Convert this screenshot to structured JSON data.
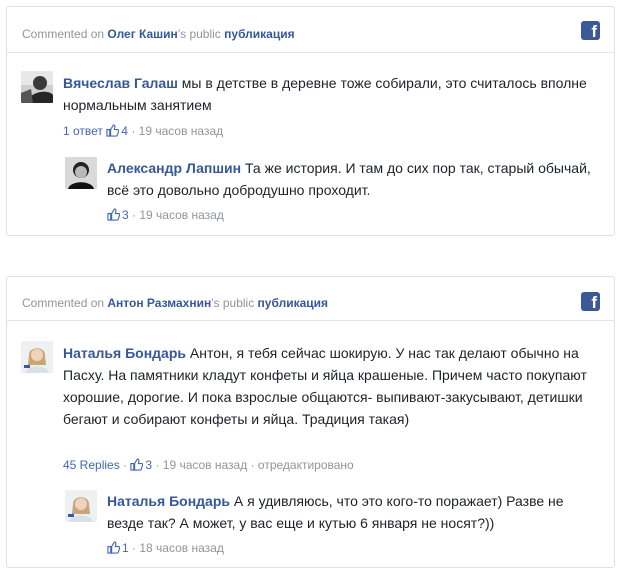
{
  "cards": [
    {
      "header": {
        "prefix": "Commented on",
        "page_name": "Олег Кашин",
        "possessive": "'s public",
        "link": "публикация",
        "fb_glyph": "f"
      },
      "comment": {
        "author": "Вячеслав Галаш",
        "text": "мы в детстве в деревне тоже собирали, это считалось вполне нормальным занятием",
        "replies": "1 ответ",
        "likes": "4",
        "time": "19 часов назад"
      },
      "reply": {
        "author": "Александр Лапшин",
        "text": "Та же история. И там до сих пор так, старый обычай, всё это довольно добродушно проходит.",
        "likes": "3",
        "time": "19 часов назад"
      }
    },
    {
      "header": {
        "prefix": "Commented on",
        "page_name": "Антон Размахнин",
        "possessive": "'s public",
        "link": "публикация",
        "fb_glyph": "f"
      },
      "comment": {
        "author": "Наталья Бондарь",
        "text": "Антон, я тебя сейчас шокирую. У нас так делают обычно на Пасху. На памятники кладут конфеты и яйца крашеные. Причем часто покупают хорошие, дорогие. И пока взрослые общаются- выпивают-закусывают, детишки бегают и собирают конфеты и яйца. Традиция такая)",
        "replies": "45 Replies",
        "likes": "3",
        "time": "19 часов назад",
        "edited": "отредактировано"
      },
      "reply": {
        "author": "Наталья Бондарь",
        "text": "А я удивляюсь, что это кого-то поражает) Разве не везде так? А может, у вас еще и кутью 6 января не носят?))",
        "likes": "1",
        "time": "18 часов назад"
      }
    }
  ],
  "separator": "·",
  "colors": {
    "link": "#365899",
    "meta": "#90949c",
    "facebook": "#3b5998"
  },
  "icons": [
    "facebook-icon",
    "thumbs-up-icon"
  ]
}
